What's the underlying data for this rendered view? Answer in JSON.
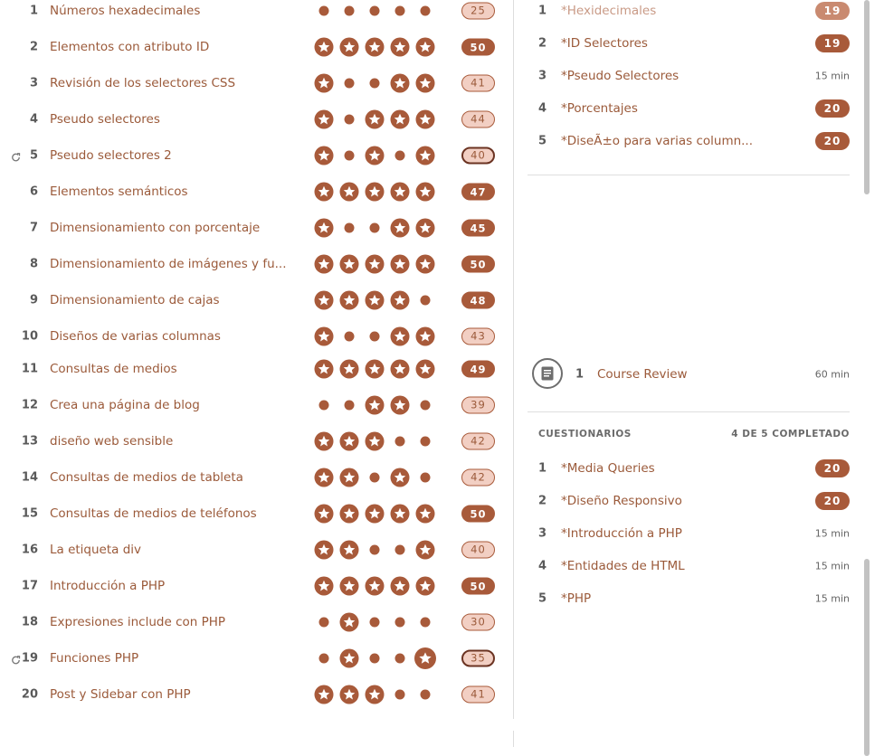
{
  "lessons": [
    {
      "num": "1",
      "title": "Números hexadecimales",
      "score": "25",
      "stars": [
        "dot",
        "dot",
        "dot",
        "dot",
        "dot"
      ],
      "style": "part",
      "redo": false
    },
    {
      "num": "2",
      "title": "Elementos con atributo ID",
      "score": "50",
      "stars": [
        "star",
        "star",
        "star",
        "star",
        "star"
      ],
      "style": "full",
      "redo": false
    },
    {
      "num": "3",
      "title": "Revisión de los selectores CSS",
      "score": "41",
      "stars": [
        "star",
        "dot",
        "dot",
        "star",
        "star"
      ],
      "style": "part",
      "redo": false
    },
    {
      "num": "4",
      "title": "Pseudo selectores",
      "score": "44",
      "stars": [
        "star",
        "dot",
        "star",
        "star",
        "star"
      ],
      "style": "part",
      "redo": false
    },
    {
      "num": "5",
      "title": "Pseudo selectores 2",
      "score": "40",
      "stars": [
        "star",
        "dot",
        "star",
        "dot",
        "star"
      ],
      "style": "dark",
      "redo": true
    },
    {
      "num": "6",
      "title": "Elementos semánticos",
      "score": "47",
      "stars": [
        "star",
        "star",
        "star",
        "star",
        "star"
      ],
      "style": "full",
      "redo": false
    },
    {
      "num": "7",
      "title": "Dimensionamiento con porcentaje",
      "score": "45",
      "stars": [
        "star",
        "dot",
        "dot",
        "star",
        "star"
      ],
      "style": "full",
      "redo": false
    },
    {
      "num": "8",
      "title": "Dimensionamiento de imágenes y fu...",
      "score": "50",
      "stars": [
        "star",
        "star",
        "star",
        "star",
        "star"
      ],
      "style": "full",
      "redo": false
    },
    {
      "num": "9",
      "title": "Dimensionamiento de cajas",
      "score": "48",
      "stars": [
        "star",
        "star",
        "star",
        "star",
        "dot"
      ],
      "style": "full",
      "redo": false
    },
    {
      "num": "10",
      "title": "Diseños de varias columnas",
      "score": "43",
      "stars": [
        "star",
        "dot",
        "dot",
        "star",
        "star"
      ],
      "style": "part",
      "redo": false
    },
    {
      "num": "11",
      "title": "Consultas de medios",
      "score": "49",
      "stars": [
        "star",
        "star",
        "star",
        "star",
        "star"
      ],
      "style": "full",
      "redo": false
    },
    {
      "num": "12",
      "title": "Crea una página de blog",
      "score": "39",
      "stars": [
        "dot",
        "dot",
        "star",
        "star",
        "dot"
      ],
      "style": "part",
      "redo": false
    },
    {
      "num": "13",
      "title": "diseño web sensible",
      "score": "42",
      "stars": [
        "star",
        "star",
        "star",
        "dot",
        "dot"
      ],
      "style": "part",
      "redo": false
    },
    {
      "num": "14",
      "title": "Consultas de medios de tableta",
      "score": "42",
      "stars": [
        "star",
        "star",
        "dot",
        "star",
        "dot"
      ],
      "style": "part",
      "redo": false
    },
    {
      "num": "15",
      "title": "Consultas de medios de teléfonos",
      "score": "50",
      "stars": [
        "star",
        "star",
        "star",
        "star",
        "star"
      ],
      "style": "full",
      "redo": false
    },
    {
      "num": "16",
      "title": "La etiqueta div",
      "score": "40",
      "stars": [
        "star",
        "star",
        "dot",
        "dot",
        "star"
      ],
      "style": "part",
      "redo": false
    },
    {
      "num": "17",
      "title": "Introducción a PHP",
      "score": "50",
      "stars": [
        "star",
        "star",
        "star",
        "star",
        "star"
      ],
      "style": "full",
      "redo": false
    },
    {
      "num": "18",
      "title": "Expresiones include con PHP",
      "score": "30",
      "stars": [
        "dot",
        "star",
        "dot",
        "dot",
        "dot"
      ],
      "style": "part",
      "redo": false
    },
    {
      "num": "19",
      "title": "Funciones PHP",
      "score": "35",
      "stars": [
        "dot",
        "star",
        "dot",
        "dot",
        "bigstar"
      ],
      "style": "dark",
      "redo": true
    },
    {
      "num": "20",
      "title": "Post y Sidebar con PHP",
      "score": "41",
      "stars": [
        "star",
        "star",
        "star",
        "dot",
        "dot"
      ],
      "style": "part",
      "redo": false
    }
  ],
  "practice": [
    {
      "num": "1",
      "title": "*Hexidecimales",
      "badge": "19",
      "time": "",
      "faded": true
    },
    {
      "num": "2",
      "title": "*ID Selectores",
      "badge": "19",
      "time": "",
      "faded": false
    },
    {
      "num": "3",
      "title": "*Pseudo Selectores",
      "badge": "",
      "time": "15 min",
      "faded": false
    },
    {
      "num": "4",
      "title": "*Porcentajes",
      "badge": "20",
      "time": "",
      "faded": false
    },
    {
      "num": "5",
      "title": "*DiseÃ±o para varias column...",
      "badge": "20",
      "time": "",
      "faded": false
    }
  ],
  "review": {
    "num": "1",
    "title": "Course Review",
    "time": "60 min",
    "icon": "document-icon"
  },
  "quizzes": {
    "header": "CUESTIONARIOS",
    "status": "4 DE 5 COMPLETADO",
    "items": [
      {
        "num": "1",
        "title": "*Media Queries",
        "badge": "20",
        "time": ""
      },
      {
        "num": "2",
        "title": "*Diseño Responsivo",
        "badge": "20",
        "time": ""
      },
      {
        "num": "3",
        "title": "*Introducción a PHP",
        "badge": "",
        "time": "15 min"
      },
      {
        "num": "4",
        "title": "*Entidades de HTML",
        "badge": "",
        "time": "15 min"
      },
      {
        "num": "5",
        "title": "*PHP",
        "badge": "",
        "time": "15 min"
      }
    ]
  },
  "colors": {
    "accent": "#a85a3a",
    "accent_light": "#f2cfc3",
    "text": "#9b5a3a"
  }
}
